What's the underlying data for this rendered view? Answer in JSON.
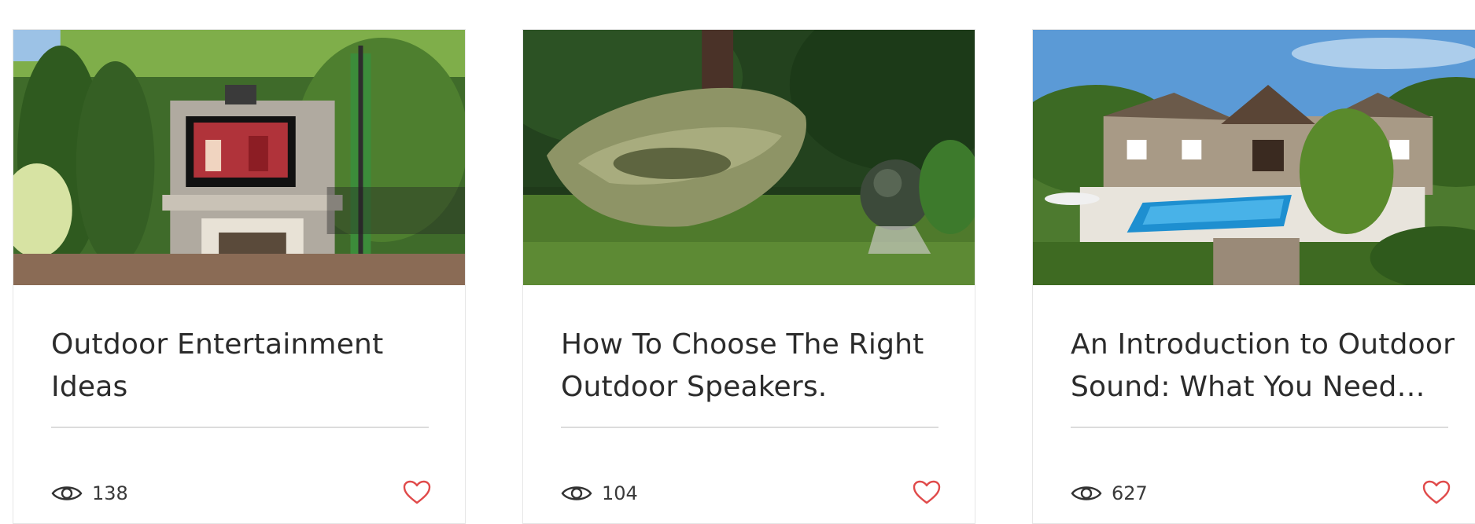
{
  "posts": [
    {
      "title": "Outdoor Entertainment Ideas",
      "views": "138",
      "image": "outdoor-tv-fireplace-photo",
      "view_icon": "eye-icon",
      "like_icon": "heart-icon"
    },
    {
      "title": "How To Choose The Right Outdoor Speakers.",
      "views": "104",
      "image": "garden-sculpture-speaker-photo",
      "view_icon": "eye-icon",
      "like_icon": "heart-icon"
    },
    {
      "title": "An Introduction to Outdoor Sound: What You Need to…",
      "views": "627",
      "image": "backyard-pool-house-photo",
      "view_icon": "eye-icon",
      "like_icon": "heart-icon"
    }
  ],
  "colors": {
    "title": "#2b2b2b",
    "divider": "#dcdcdc",
    "heart": "#e04a4a",
    "text": "#3a3a3a"
  }
}
